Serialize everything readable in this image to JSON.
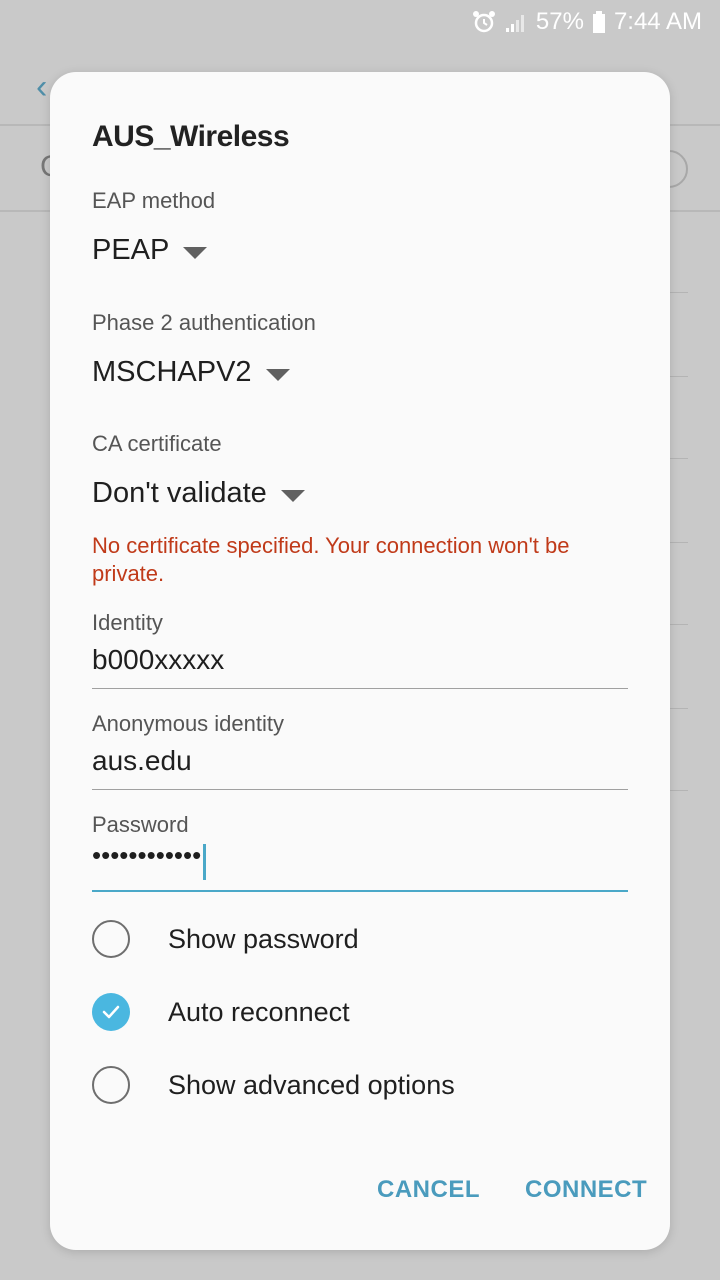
{
  "status_bar": {
    "battery": "57%",
    "time": "7:44 AM",
    "icons": [
      "alarm-icon",
      "signal-icon",
      "battery-icon"
    ]
  },
  "dialog": {
    "title": "AUS_Wireless",
    "eap": {
      "label": "EAP method",
      "value": "PEAP"
    },
    "phase2": {
      "label": "Phase 2 authentication",
      "value": "MSCHAPV2"
    },
    "ca": {
      "label": "CA certificate",
      "value": "Don't validate"
    },
    "warning": "No certificate specified. Your connection won't be private.",
    "identity": {
      "label": "Identity",
      "value": "b000xxxxx"
    },
    "anonymous": {
      "label": "Anonymous identity",
      "value": "aus.edu"
    },
    "password": {
      "label": "Password",
      "value": "••••••••••••"
    },
    "options": [
      {
        "label": "Show password",
        "checked": false
      },
      {
        "label": "Auto reconnect",
        "checked": true
      },
      {
        "label": "Show advanced options",
        "checked": false
      }
    ],
    "buttons": {
      "cancel": "CANCEL",
      "connect": "CONNECT"
    }
  },
  "colors": {
    "accent": "#4aa8c8",
    "warning": "#c03a19",
    "check": "#4ab7e0"
  }
}
